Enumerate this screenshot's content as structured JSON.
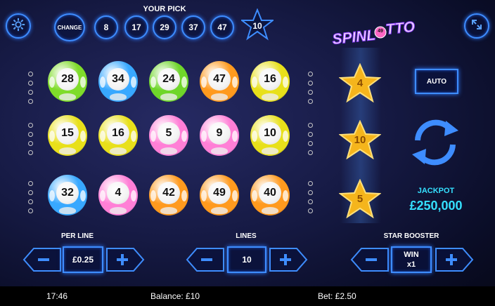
{
  "header": {
    "your_pick_title": "YOUR PICK",
    "change_label": "CHANGE",
    "picks": [
      "8",
      "17",
      "29",
      "37",
      "47"
    ],
    "star_pick": "10"
  },
  "logo": {
    "text": "SPINLOTTO",
    "badge": "49"
  },
  "grid": {
    "rows": [
      [
        {
          "number": "28",
          "color": "#7fdc2a"
        },
        {
          "number": "34",
          "color": "#38a8ff"
        },
        {
          "number": "24",
          "color": "#6fd62a"
        },
        {
          "number": "47",
          "color": "#ff9a1e"
        },
        {
          "number": "16",
          "color": "#e8e01a"
        }
      ],
      [
        {
          "number": "15",
          "color": "#e8e01a"
        },
        {
          "number": "16",
          "color": "#e8e01a"
        },
        {
          "number": "5",
          "color": "#ff7fd6"
        },
        {
          "number": "9",
          "color": "#ff7fd6"
        },
        {
          "number": "10",
          "color": "#e8e01a"
        }
      ],
      [
        {
          "number": "32",
          "color": "#38a8ff"
        },
        {
          "number": "4",
          "color": "#ff7fd6"
        },
        {
          "number": "42",
          "color": "#ff9a1e"
        },
        {
          "number": "49",
          "color": "#ff9a1e"
        },
        {
          "number": "40",
          "color": "#ff9a1e"
        }
      ]
    ]
  },
  "reel_stars": [
    "4",
    "10",
    "5"
  ],
  "auto_label": "AUTO",
  "jackpot": {
    "label": "JACKPOT",
    "value": "£250,000"
  },
  "controls": {
    "per_line": {
      "label": "PER LINE",
      "value": "£0.25"
    },
    "lines": {
      "label": "LINES",
      "value": "10"
    },
    "star_booster": {
      "label": "STAR BOOSTER",
      "value_line1": "WIN",
      "value_line2": "x1"
    }
  },
  "status": {
    "time": "17:46",
    "balance": "Balance: £10",
    "bet": "Bet: £2.50"
  },
  "colors": {
    "neon_blue": "#3e8dff",
    "jackpot": "#35e0ff",
    "star_gold": "#f5b51c"
  }
}
